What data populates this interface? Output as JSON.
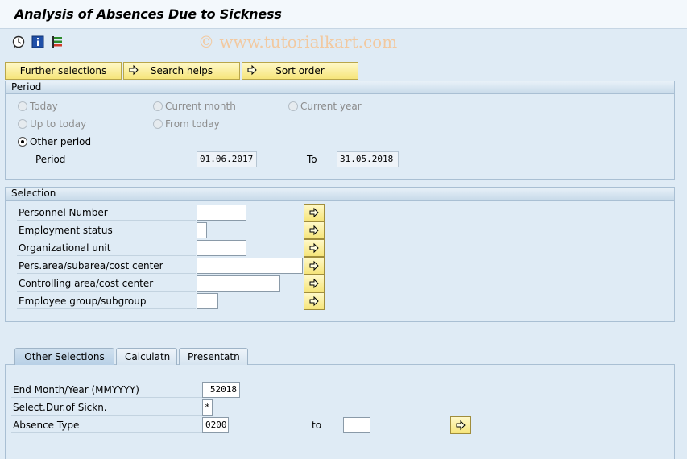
{
  "window": {
    "title": "Analysis of Absences Due to Sickness"
  },
  "watermark": "© www.tutorialkart.com",
  "toolbar": {
    "icons": [
      "execute-icon",
      "info-icon",
      "selection-options-icon"
    ]
  },
  "selection_buttons": {
    "further_selections": "Further selections",
    "search_helps": "Search helps",
    "sort_order": "Sort order"
  },
  "period": {
    "header": "Period",
    "options": {
      "today": "Today",
      "current_month": "Current month",
      "current_year": "Current year",
      "up_to_today": "Up to today",
      "from_today": "From today",
      "other_period": "Other period"
    },
    "selected": "Other period",
    "period_label": "Period",
    "from_value": "01.06.2017",
    "to_label": "To",
    "to_value": "31.05.2018"
  },
  "selection": {
    "header": "Selection",
    "fields": [
      {
        "label": "Personnel Number",
        "value": ""
      },
      {
        "label": "Employment status",
        "value": ""
      },
      {
        "label": "Organizational unit",
        "value": ""
      },
      {
        "label": "Pers.area/subarea/cost center",
        "value": ""
      },
      {
        "label": "Controlling area/cost center",
        "value": ""
      },
      {
        "label": "Employee group/subgroup",
        "value": ""
      }
    ]
  },
  "tabs": {
    "items": [
      "Other Selections",
      "Calculatn",
      "Presentatn"
    ],
    "active": "Other Selections"
  },
  "other_selections": {
    "end_month_label": "End Month/Year (MMYYYY)",
    "end_month_value": "52018",
    "duration_label": "Select.Dur.of Sickn.",
    "duration_value": "*",
    "absence_type_label": "Absence Type",
    "absence_type_from": "0200",
    "to_label": "to",
    "absence_type_to": ""
  },
  "colors": {
    "background": "#dfebf5",
    "button_yellow": "#f6e57a",
    "watermark": "#f2c9a0"
  }
}
